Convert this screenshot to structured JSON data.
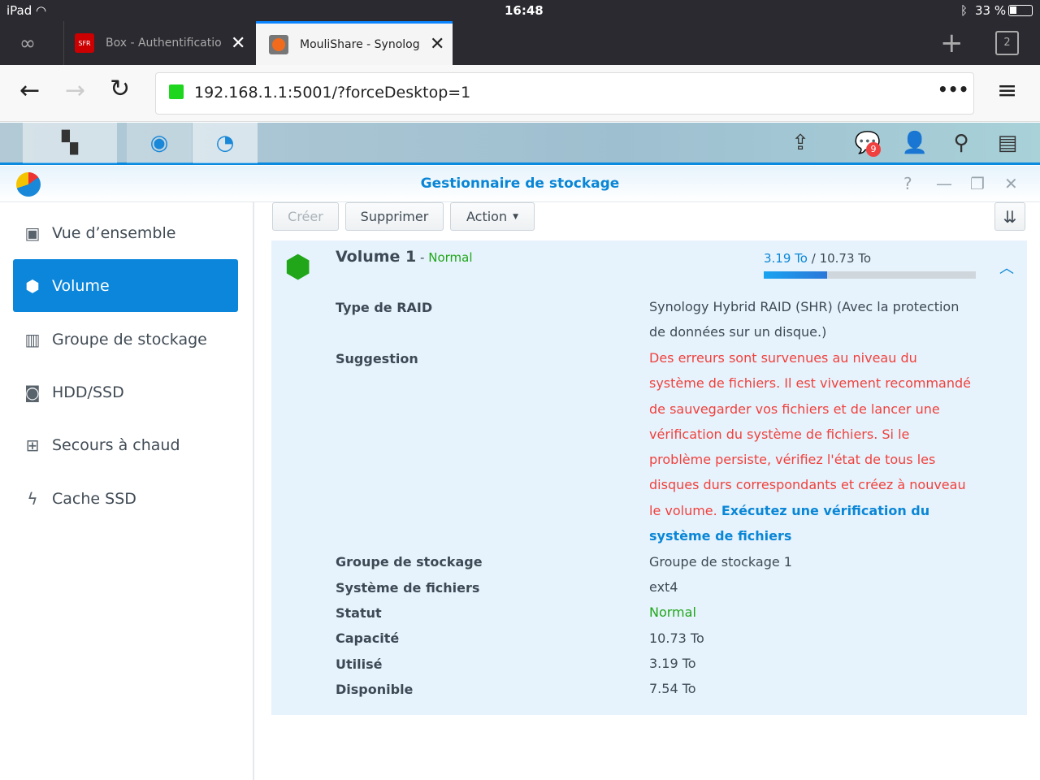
{
  "status_bar": {
    "device": "iPad",
    "time": "16:48",
    "battery": "33 %"
  },
  "browser": {
    "tabs": [
      {
        "title": "Box - Authentification",
        "favicon": "SFR"
      },
      {
        "title": "MouliShare - Synology",
        "active": true
      }
    ],
    "tab_count": "2",
    "url": "192.168.1.1:5001/?forceDesktop=1"
  },
  "dsm": {
    "notification_count": "9"
  },
  "window": {
    "title": "Gestionnaire de stockage"
  },
  "sidebar": {
    "items": [
      {
        "label": "Vue d’ensemble",
        "icon": "overview-icon"
      },
      {
        "label": "Volume",
        "icon": "volume-icon",
        "active": true
      },
      {
        "label": "Groupe de stockage",
        "icon": "storage-pool-icon"
      },
      {
        "label": "HDD/SSD",
        "icon": "hdd-icon"
      },
      {
        "label": "Secours à chaud",
        "icon": "hot-spare-icon"
      },
      {
        "label": "Cache SSD",
        "icon": "ssd-cache-icon"
      }
    ]
  },
  "toolbar": {
    "create": "Créer",
    "delete": "Supprimer",
    "action": "Action"
  },
  "volume": {
    "name": "Volume 1",
    "separator": " - ",
    "status": "Normal",
    "used": "3.19 To",
    "slash": " / ",
    "total": "10.73 To",
    "usage_percent": 29.7,
    "details": [
      {
        "label": "Type de RAID",
        "value": "Synology Hybrid RAID (SHR) (Avec la protection de données sur un disque.)"
      },
      {
        "label": "Suggestion",
        "value": "Des erreurs sont survenues au niveau du système de fichiers. Il est vivement recommandé de sauvegarder vos fichiers et de lancer une vérification du système de fichiers. Si le problème persiste, vérifiez l'état de tous les disques durs correspondants et créez à nouveau le volume.",
        "link": "Exécutez une vérification du système de fichiers"
      },
      {
        "label": "Groupe de stockage",
        "value": "Groupe de stockage 1"
      },
      {
        "label": "Système de fichiers",
        "value": "ext4"
      },
      {
        "label": "Statut",
        "value": "Normal"
      },
      {
        "label": "Capacité",
        "value": "10.73 To"
      },
      {
        "label": "Utilisé",
        "value": "3.19 To"
      },
      {
        "label": "Disponible",
        "value": "7.54 To"
      }
    ]
  }
}
